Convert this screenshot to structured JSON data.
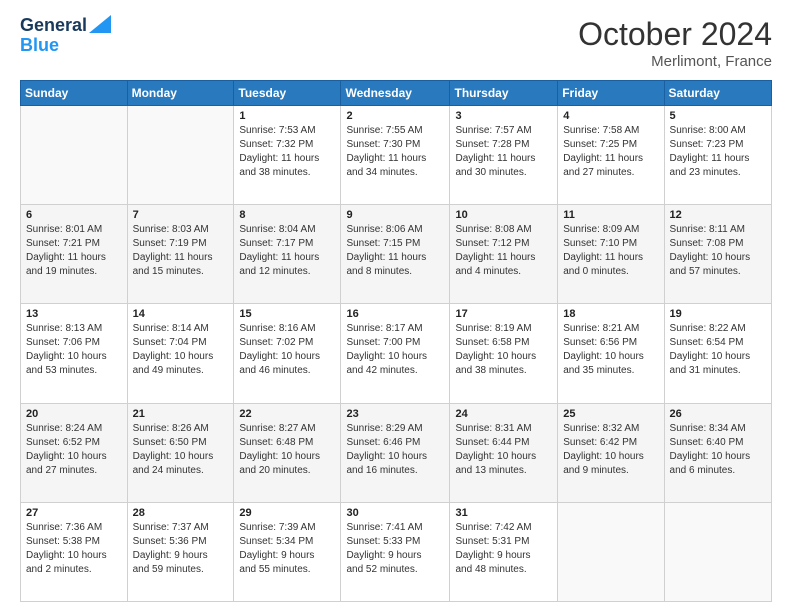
{
  "header": {
    "logo_line1": "General",
    "logo_line2": "Blue",
    "month": "October 2024",
    "location": "Merlimont, France"
  },
  "weekdays": [
    "Sunday",
    "Monday",
    "Tuesday",
    "Wednesday",
    "Thursday",
    "Friday",
    "Saturday"
  ],
  "weeks": [
    [
      {
        "day": "",
        "info": ""
      },
      {
        "day": "",
        "info": ""
      },
      {
        "day": "1",
        "info": "Sunrise: 7:53 AM\nSunset: 7:32 PM\nDaylight: 11 hours\nand 38 minutes."
      },
      {
        "day": "2",
        "info": "Sunrise: 7:55 AM\nSunset: 7:30 PM\nDaylight: 11 hours\nand 34 minutes."
      },
      {
        "day": "3",
        "info": "Sunrise: 7:57 AM\nSunset: 7:28 PM\nDaylight: 11 hours\nand 30 minutes."
      },
      {
        "day": "4",
        "info": "Sunrise: 7:58 AM\nSunset: 7:25 PM\nDaylight: 11 hours\nand 27 minutes."
      },
      {
        "day": "5",
        "info": "Sunrise: 8:00 AM\nSunset: 7:23 PM\nDaylight: 11 hours\nand 23 minutes."
      }
    ],
    [
      {
        "day": "6",
        "info": "Sunrise: 8:01 AM\nSunset: 7:21 PM\nDaylight: 11 hours\nand 19 minutes."
      },
      {
        "day": "7",
        "info": "Sunrise: 8:03 AM\nSunset: 7:19 PM\nDaylight: 11 hours\nand 15 minutes."
      },
      {
        "day": "8",
        "info": "Sunrise: 8:04 AM\nSunset: 7:17 PM\nDaylight: 11 hours\nand 12 minutes."
      },
      {
        "day": "9",
        "info": "Sunrise: 8:06 AM\nSunset: 7:15 PM\nDaylight: 11 hours\nand 8 minutes."
      },
      {
        "day": "10",
        "info": "Sunrise: 8:08 AM\nSunset: 7:12 PM\nDaylight: 11 hours\nand 4 minutes."
      },
      {
        "day": "11",
        "info": "Sunrise: 8:09 AM\nSunset: 7:10 PM\nDaylight: 11 hours\nand 0 minutes."
      },
      {
        "day": "12",
        "info": "Sunrise: 8:11 AM\nSunset: 7:08 PM\nDaylight: 10 hours\nand 57 minutes."
      }
    ],
    [
      {
        "day": "13",
        "info": "Sunrise: 8:13 AM\nSunset: 7:06 PM\nDaylight: 10 hours\nand 53 minutes."
      },
      {
        "day": "14",
        "info": "Sunrise: 8:14 AM\nSunset: 7:04 PM\nDaylight: 10 hours\nand 49 minutes."
      },
      {
        "day": "15",
        "info": "Sunrise: 8:16 AM\nSunset: 7:02 PM\nDaylight: 10 hours\nand 46 minutes."
      },
      {
        "day": "16",
        "info": "Sunrise: 8:17 AM\nSunset: 7:00 PM\nDaylight: 10 hours\nand 42 minutes."
      },
      {
        "day": "17",
        "info": "Sunrise: 8:19 AM\nSunset: 6:58 PM\nDaylight: 10 hours\nand 38 minutes."
      },
      {
        "day": "18",
        "info": "Sunrise: 8:21 AM\nSunset: 6:56 PM\nDaylight: 10 hours\nand 35 minutes."
      },
      {
        "day": "19",
        "info": "Sunrise: 8:22 AM\nSunset: 6:54 PM\nDaylight: 10 hours\nand 31 minutes."
      }
    ],
    [
      {
        "day": "20",
        "info": "Sunrise: 8:24 AM\nSunset: 6:52 PM\nDaylight: 10 hours\nand 27 minutes."
      },
      {
        "day": "21",
        "info": "Sunrise: 8:26 AM\nSunset: 6:50 PM\nDaylight: 10 hours\nand 24 minutes."
      },
      {
        "day": "22",
        "info": "Sunrise: 8:27 AM\nSunset: 6:48 PM\nDaylight: 10 hours\nand 20 minutes."
      },
      {
        "day": "23",
        "info": "Sunrise: 8:29 AM\nSunset: 6:46 PM\nDaylight: 10 hours\nand 16 minutes."
      },
      {
        "day": "24",
        "info": "Sunrise: 8:31 AM\nSunset: 6:44 PM\nDaylight: 10 hours\nand 13 minutes."
      },
      {
        "day": "25",
        "info": "Sunrise: 8:32 AM\nSunset: 6:42 PM\nDaylight: 10 hours\nand 9 minutes."
      },
      {
        "day": "26",
        "info": "Sunrise: 8:34 AM\nSunset: 6:40 PM\nDaylight: 10 hours\nand 6 minutes."
      }
    ],
    [
      {
        "day": "27",
        "info": "Sunrise: 7:36 AM\nSunset: 5:38 PM\nDaylight: 10 hours\nand 2 minutes."
      },
      {
        "day": "28",
        "info": "Sunrise: 7:37 AM\nSunset: 5:36 PM\nDaylight: 9 hours\nand 59 minutes."
      },
      {
        "day": "29",
        "info": "Sunrise: 7:39 AM\nSunset: 5:34 PM\nDaylight: 9 hours\nand 55 minutes."
      },
      {
        "day": "30",
        "info": "Sunrise: 7:41 AM\nSunset: 5:33 PM\nDaylight: 9 hours\nand 52 minutes."
      },
      {
        "day": "31",
        "info": "Sunrise: 7:42 AM\nSunset: 5:31 PM\nDaylight: 9 hours\nand 48 minutes."
      },
      {
        "day": "",
        "info": ""
      },
      {
        "day": "",
        "info": ""
      }
    ]
  ]
}
